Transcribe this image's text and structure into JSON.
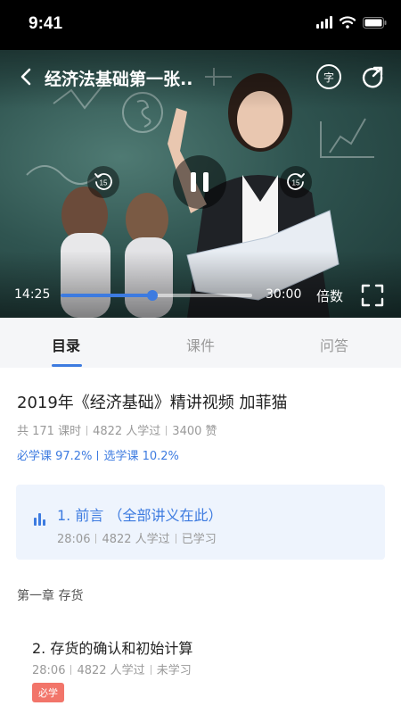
{
  "status_bar": {
    "time": "9:41"
  },
  "player": {
    "title": "经济法基础第一张..",
    "subtitle_icon_label": "字",
    "rewind_seconds": "15",
    "forward_seconds": "15",
    "current_time": "14:25",
    "total_time": "30:00",
    "progress_percent": 48,
    "speed_label": "倍数",
    "icons": [
      "back-icon",
      "subtitle-icon",
      "share-icon",
      "rewind-15-icon",
      "pause-icon",
      "forward-15-icon",
      "fullscreen-icon"
    ],
    "accent_color": "#3d7be0"
  },
  "tabs": [
    {
      "label": "目录",
      "active": true
    },
    {
      "label": "课件",
      "active": false
    },
    {
      "label": "问答",
      "active": false
    }
  ],
  "course": {
    "title": "2019年《经济基础》精讲视频  加菲猫",
    "lessons_count": "共 171 课时",
    "learners": "4822 人学过",
    "likes": "3400 赞",
    "required_progress": "必学课 97.2%",
    "elective_progress": "选学课 10.2%"
  },
  "current_lesson": {
    "title": "1. 前言 （全部讲义在此）",
    "duration": "28:06",
    "learners": "4822 人学过",
    "status": "已学习"
  },
  "chapter": {
    "title": "第一章 存货"
  },
  "lessons": [
    {
      "title": "2. 存货的确认和初始计算",
      "duration": "28:06",
      "learners": "4822 人学过",
      "status": "未学习",
      "badge": "必学",
      "badge_color": "#f2756a"
    }
  ]
}
